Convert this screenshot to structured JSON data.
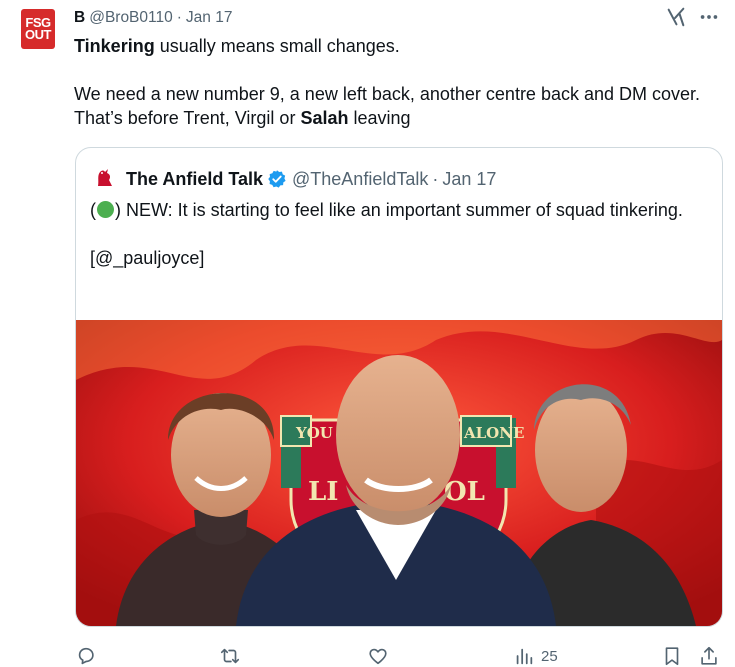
{
  "author": {
    "display_name": "B",
    "handle": "@BroB0110",
    "date": "Jan 17",
    "avatar_text": [
      "FSG",
      "OUT"
    ]
  },
  "tweet": {
    "parts": [
      {
        "text": "Tinkering",
        "bold": true
      },
      {
        "text": " usually means small changes.\n\nWe need a new number 9, a new left back, another centre back and DM cover. That’s before Trent, Virgil or ",
        "bold": false
      },
      {
        "text": "Salah",
        "bold": true
      },
      {
        "text": " leaving",
        "bold": false
      }
    ]
  },
  "quote": {
    "display_name": "The Anfield Talk",
    "handle": "@TheAnfieldTalk",
    "date": "Jan 17",
    "text_line1_prefix": "(",
    "text_line1_suffix": ") NEW: It is starting to feel like an important summer of squad tinkering.",
    "text_line2": "[@_pauljoyce]",
    "media_banner_left": "YOU",
    "media_banner_right": "ALONE",
    "media_crest_text_left": "LI",
    "media_crest_text_right": "OL"
  },
  "actions": {
    "reply": "",
    "retweet": "",
    "like": "",
    "views": "25",
    "bookmark": "",
    "share": ""
  },
  "colors": {
    "muted": "#536471",
    "brand_red": "#d62b2b",
    "verified_blue": "#1d9bf0",
    "green_emoji": "#4caf50"
  },
  "icons": [
    "grok-icon",
    "more-icon",
    "verified-icon",
    "reply-icon",
    "retweet-icon",
    "like-icon",
    "views-icon",
    "bookmark-icon",
    "share-icon"
  ]
}
